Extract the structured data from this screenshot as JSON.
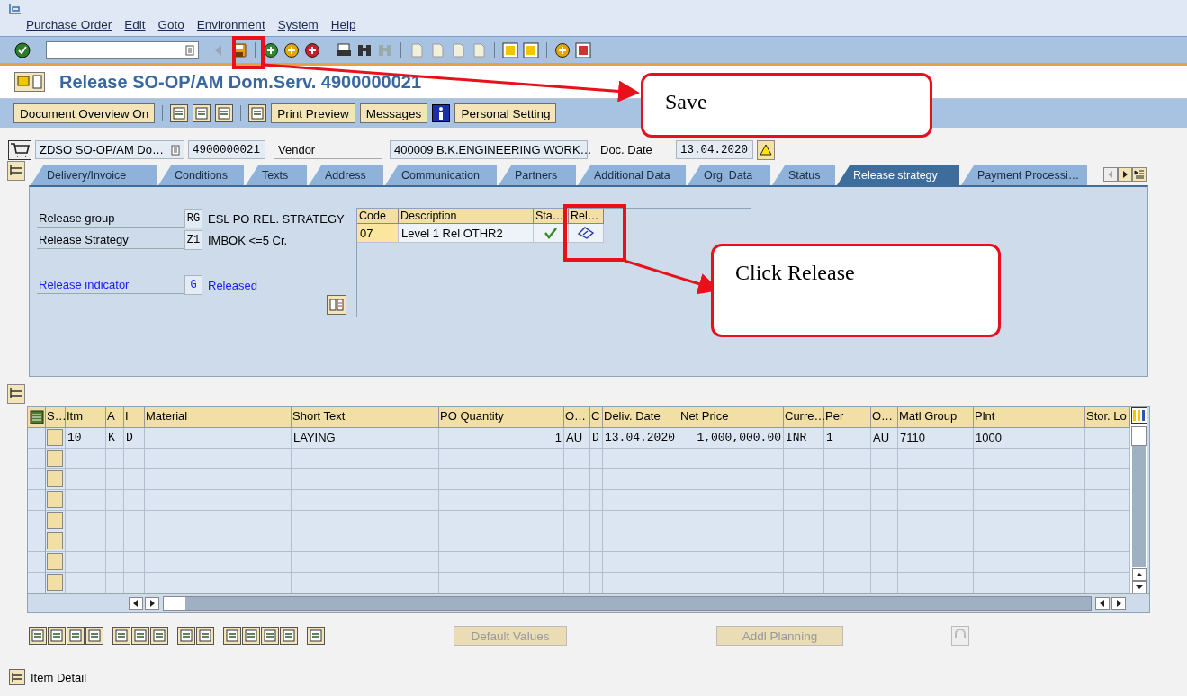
{
  "menu": [
    "Purchase Order",
    "Edit",
    "Goto",
    "Environment",
    "System",
    "Help"
  ],
  "title": "Release SO-OP/AM Dom.Serv. 4900000021",
  "app_toolbar": [
    "Document Overview On",
    "Print Preview",
    "Messages",
    "Personal Setting"
  ],
  "header": {
    "doc_type": "ZDSO SO-OP/AM Do…",
    "po_number": "4900000021",
    "vendor_label": "Vendor",
    "vendor": "400009 B.K.ENGINEERING WORK…",
    "date_label": "Doc. Date",
    "date": "13.04.2020"
  },
  "tabs": [
    {
      "label": "Delivery/Invoice",
      "selected": false
    },
    {
      "label": "Conditions",
      "selected": false
    },
    {
      "label": "Texts",
      "selected": false
    },
    {
      "label": "Address",
      "selected": false
    },
    {
      "label": "Communication",
      "selected": false
    },
    {
      "label": "Partners",
      "selected": false
    },
    {
      "label": "Additional Data",
      "selected": false
    },
    {
      "label": "Org. Data",
      "selected": false
    },
    {
      "label": "Status",
      "selected": false
    },
    {
      "label": "Release strategy",
      "selected": true
    },
    {
      "label": "Payment Processi…",
      "selected": false
    }
  ],
  "release": {
    "fields": [
      {
        "kind": "plain",
        "label": "Release group",
        "code": "RG",
        "text": "ESL PO REL. STRATEGY"
      },
      {
        "kind": "plain",
        "label": "Release Strategy",
        "code": "Z1",
        "text": "IMBOK <=5 Cr."
      },
      {
        "kind": "link",
        "label": "Release indicator",
        "code": "G",
        "text": "Released"
      }
    ],
    "columns": [
      "Code",
      "Description",
      "Sta…",
      "Rel…"
    ],
    "rows": [
      {
        "code": "07",
        "description": "Level 1 Rel OTHR2",
        "released": true
      }
    ]
  },
  "items_table": {
    "columns": [
      "S…",
      "Itm",
      "A",
      "I",
      "Material",
      "Short Text",
      "PO Quantity",
      "O…",
      "C",
      "Deliv. Date",
      "Net Price",
      "Curre…",
      "Per",
      "O…",
      "Matl Group",
      "Plnt",
      "Stor. Lo"
    ],
    "rows": [
      [
        null,
        "10",
        "K",
        "D",
        null,
        "LAYING",
        "1",
        "AU",
        "D",
        "13.04.2020",
        "1,000,000.00",
        "INR",
        "1",
        "AU",
        "7110",
        "1000",
        null
      ]
    ]
  },
  "bottom_buttons": [
    {
      "label": "Default Values",
      "disabled": true
    },
    {
      "label": "Addl Planning",
      "disabled": true
    }
  ],
  "status": "Item Detail",
  "annotations": [
    {
      "text": "Save"
    },
    {
      "text": "Click Release"
    }
  ]
}
